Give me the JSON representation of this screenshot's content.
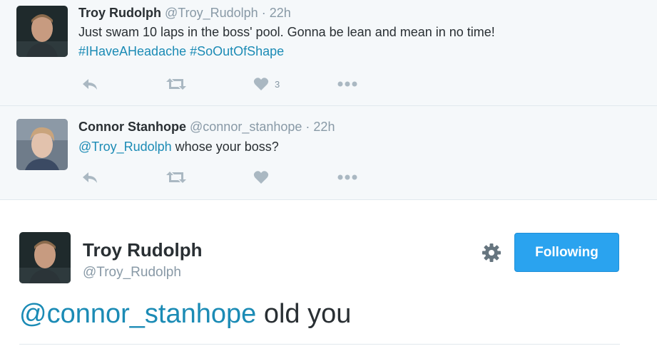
{
  "tweets": [
    {
      "name": "Troy Rudolph",
      "handle": "@Troy_Rudolph",
      "time": "· 22h",
      "text": "Just swam 10 laps in the boss' pool. Gonna be lean and mean in no time!",
      "hashtags": "#IHaveAHeadache #SoOutOfShape",
      "like_count": "3"
    },
    {
      "name": "Connor Stanhope",
      "handle": "@connor_stanhope",
      "time": "· 22h",
      "mention": "@Troy_Rudolph",
      "text": " whose your boss?"
    }
  ],
  "main": {
    "name": "Troy Rudolph",
    "handle": "@Troy_Rudolph",
    "follow_label": "Following",
    "mention": "@connor_stanhope",
    "text": " old you"
  },
  "colors": {
    "link": "#1b8bb5",
    "follow_button": "#2aa3ef",
    "action_icon": "#aab8c2",
    "tweet_bg": "#f5f8fa"
  },
  "icons": [
    "reply-icon",
    "retweet-icon",
    "heart-icon",
    "more-icon",
    "gear-icon"
  ]
}
